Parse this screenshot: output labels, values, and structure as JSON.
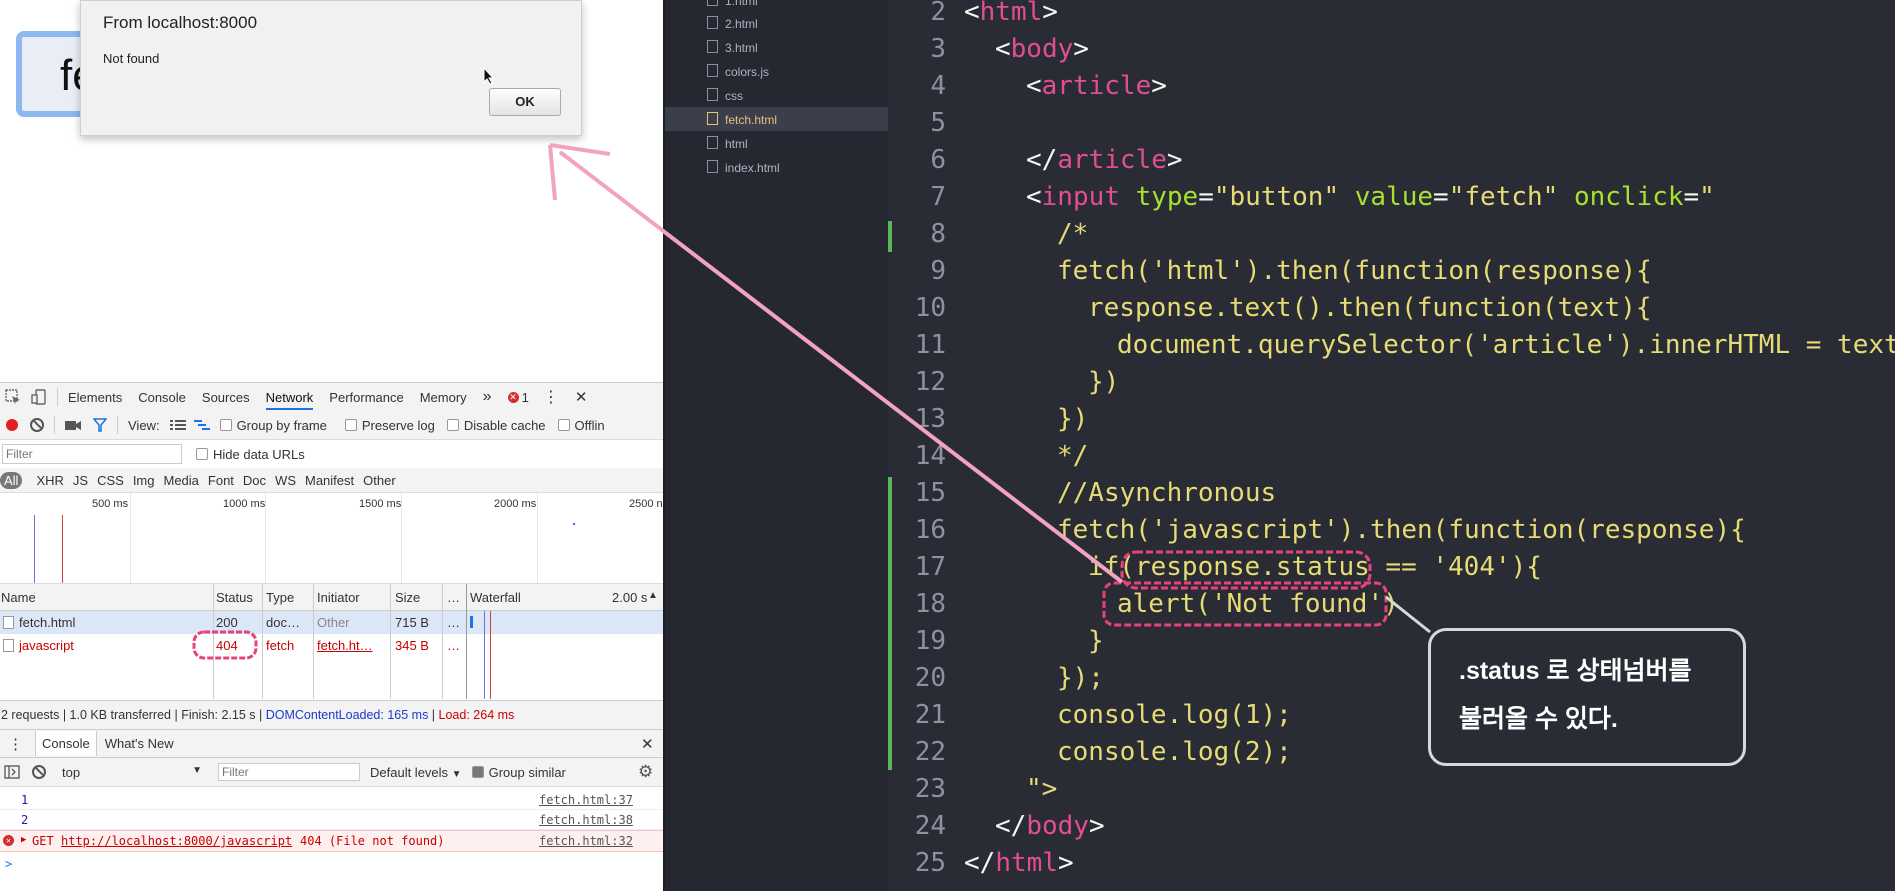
{
  "alert": {
    "title": "From localhost:8000",
    "message": "Not found",
    "ok_label": "OK"
  },
  "page": {
    "button_text": "fe"
  },
  "devtools": {
    "tabs": [
      "Elements",
      "Console",
      "Sources",
      "Network",
      "Performance",
      "Memory"
    ],
    "more": "»",
    "error_count": "1",
    "view_label": "View:",
    "options": [
      "Group by frame",
      "Preserve log",
      "Disable cache",
      "Offlin"
    ],
    "filter_placeholder": "Filter",
    "hide_data_urls": "Hide data URLs",
    "types": [
      "All",
      "XHR",
      "JS",
      "CSS",
      "Img",
      "Media",
      "Font",
      "Doc",
      "WS",
      "Manifest",
      "Other"
    ],
    "timeline": [
      "500 ms",
      "1000 ms",
      "1500 ms",
      "2000 ms",
      "2500 n"
    ],
    "columns": {
      "name": "Name",
      "status": "Status",
      "type": "Type",
      "initiator": "Initiator",
      "size": "Size",
      "more": "…",
      "waterfall": "Waterfall",
      "sort": "2.00 s"
    },
    "rows": [
      {
        "name": "fetch.html",
        "status": "200",
        "type": "doc…",
        "initiator": "Other",
        "size": "715 B",
        "more": "…"
      },
      {
        "name": "javascript",
        "status": "404",
        "type": "fetch",
        "initiator": "fetch.ht…",
        "size": "345 B",
        "more": "…"
      }
    ],
    "summary": {
      "requests": "2 requests | 1.0 KB transferred | Finish: 2.15 s | ",
      "dcl": "DOMContentLoaded: 165 ms",
      "sep": " | ",
      "load": "Load: 264 ms"
    },
    "drawer_tabs": [
      "Console",
      "What's New"
    ],
    "console_context": "top",
    "console_filter": "Filter",
    "levels": "Default levels",
    "group_similar": "Group similar",
    "logs": [
      {
        "text": "1",
        "src": "fetch.html:37"
      },
      {
        "text": "2",
        "src": "fetch.html:38"
      }
    ],
    "error": {
      "method": "GET",
      "url": "http://localhost:8000/javascript",
      "msg": "404 (File not found)",
      "src": "fetch.html:32"
    },
    "prompt": ">"
  },
  "tree": {
    "files": [
      "1.html",
      "2.html",
      "3.html",
      "colors.js",
      "css",
      "fetch.html",
      "html",
      "index.html"
    ],
    "selected": "fetch.html"
  },
  "code": {
    "lines": [
      "2",
      "3",
      "4",
      "5",
      "6",
      "7",
      "8",
      "9",
      "10",
      "11",
      "12",
      "13",
      "14",
      "15",
      "16",
      "17",
      "18",
      "19",
      "20",
      "21",
      "22",
      "23",
      "24",
      "25"
    ],
    "collapse_icon": "<",
    "l2": {
      "a": "<",
      "b": "html",
      "c": ">"
    },
    "l3": {
      "a": "<",
      "b": "body",
      "c": ">"
    },
    "l4": {
      "a": "<",
      "b": "article",
      "c": ">"
    },
    "l6": {
      "a": "</",
      "b": "article",
      "c": ">"
    },
    "l7": {
      "a": "<",
      "b": "input",
      "c": " ",
      "d": "type",
      "e": "=",
      "f": "\"button\"",
      "g": " ",
      "h": "value",
      "i": "=",
      "j": "\"fetch\"",
      "k": " ",
      "l": "onclick",
      "m": "=",
      "n": "\""
    },
    "l8": "/*",
    "l9": "fetch('html').then(function(response){",
    "l10": "response.text().then(function(text){",
    "l11": "document.querySelector('article').innerHTML = text;",
    "l12": "})",
    "l13": "})",
    "l14": "*/",
    "l15": "//Asynchronous",
    "l16": "fetch('javascript').then(function(response){",
    "l17": "if(response.status == '404'){",
    "l18": "alert('Not found')",
    "l19": "}",
    "l20": "});",
    "l21": "console.log(1);",
    "l22": "console.log(2);",
    "l23": "\">",
    "l24": {
      "a": "</",
      "b": "body",
      "c": ">"
    },
    "l25": {
      "a": "</",
      "b": "html",
      "c": ">"
    }
  },
  "callout": {
    "line1": ".status 로 상태넘버를",
    "line2": "불러올 수 있다."
  },
  "colors": {
    "accent": "#e24e8f",
    "string": "#e6db74",
    "attr": "#a6e22e",
    "error": "#c80000",
    "annotation": "#e8427a"
  }
}
